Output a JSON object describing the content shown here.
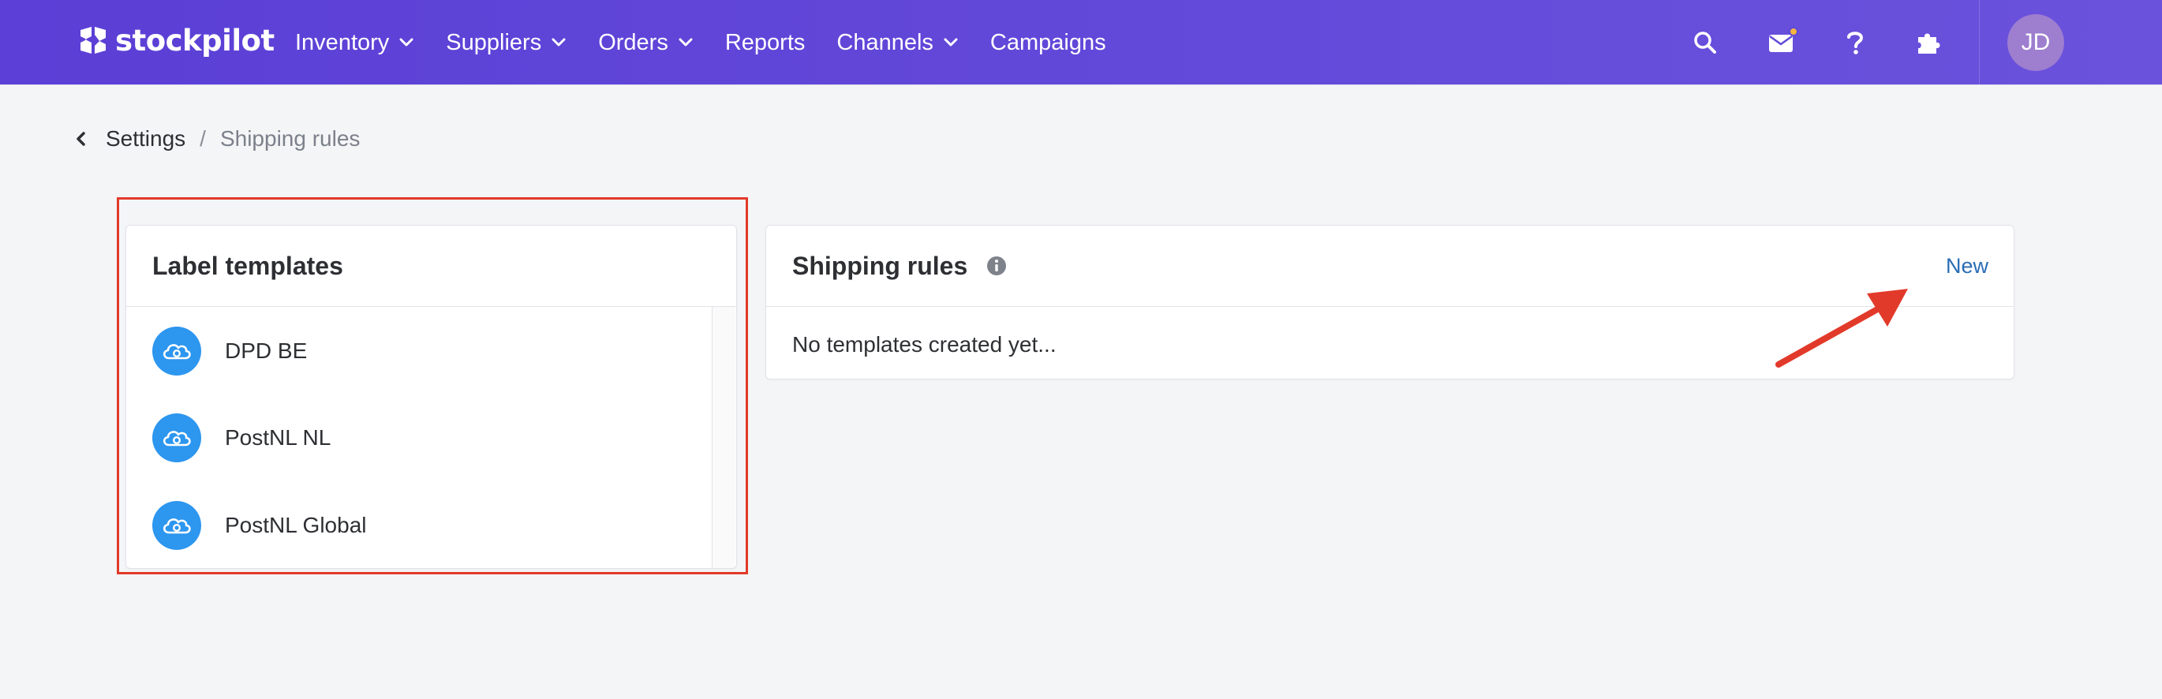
{
  "app": {
    "brand": "stockpilot",
    "nav": [
      {
        "label": "Inventory",
        "has_dropdown": true
      },
      {
        "label": "Suppliers",
        "has_dropdown": true
      },
      {
        "label": "Orders",
        "has_dropdown": true
      },
      {
        "label": "Reports",
        "has_dropdown": false
      },
      {
        "label": "Channels",
        "has_dropdown": true
      },
      {
        "label": "Campaigns",
        "has_dropdown": false
      }
    ],
    "icons": [
      "search-icon",
      "mail-icon",
      "help-icon",
      "puzzle-icon"
    ],
    "user_initials": "JD",
    "colors": {
      "nav_bg": "#5b3fd6",
      "accent_blue": "#2d96ef",
      "link": "#2a6db5",
      "annotation": "#e23a2a",
      "notification_dot": "#f3b63f",
      "avatar_bg": "#9e7ecf"
    }
  },
  "breadcrumb": {
    "parent": "Settings",
    "separator": "/",
    "current": "Shipping rules"
  },
  "label_templates": {
    "title": "Label templates",
    "items": [
      {
        "name": "DPD BE",
        "icon": "cloud-icon"
      },
      {
        "name": "PostNL NL",
        "icon": "cloud-icon"
      },
      {
        "name": "PostNL Global",
        "icon": "cloud-icon"
      }
    ]
  },
  "shipping_rules": {
    "title": "Shipping rules",
    "new_label": "New",
    "empty_text": "No templates created yet..."
  }
}
